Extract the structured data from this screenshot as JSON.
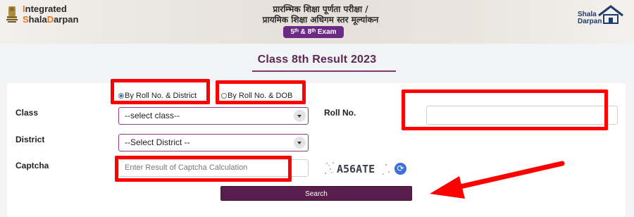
{
  "header": {
    "brand_line1_prefix": "I",
    "brand_line1_rest": "ntegrated",
    "brand_line2_prefix": "S",
    "brand_line2_rest": "hala",
    "brand_line2_prefix2": "D",
    "brand_line2_rest2": "arpan",
    "hindi_line1": "प्रारम्भिक शिक्षा पूर्णता परीक्षा /",
    "hindi_line2": "प्रायमिक शिक्षा अधिगम स्तर मूल्यांकन",
    "exam_badge": "5ᵗʰ & 8ᵗʰ Exam",
    "logo_right_line1": "Shala",
    "logo_right_line2": "Darpan"
  },
  "page": {
    "title": "Class 8th Result 2023"
  },
  "form": {
    "radio_options": [
      {
        "label": "By Roll No. & District",
        "checked": true
      },
      {
        "label": "By Roll No. & DOB",
        "checked": false
      }
    ],
    "class_label": "Class",
    "class_select": "--select class--",
    "district_label": "District",
    "district_select": "--Select District --",
    "captcha_label": "Captcha",
    "captcha_placeholder": "Enter Result of Captcha Calculation",
    "captcha_text": "A56ATE",
    "rollno_label": "Roll No.",
    "rollno_value": "",
    "search_label": "Search"
  },
  "colors": {
    "accent": "#5a1e4e",
    "title": "#5c2752",
    "annotation": "#ff0000",
    "badge": "#6b2a83"
  }
}
